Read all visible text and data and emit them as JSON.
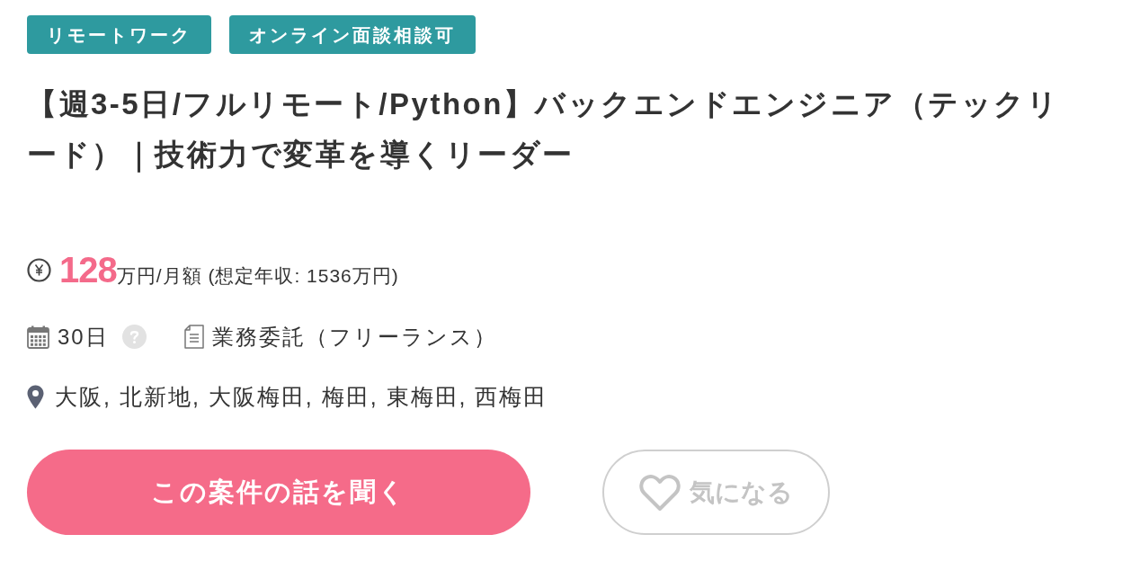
{
  "tags": [
    {
      "label": "リモートワーク"
    },
    {
      "label": "オンライン面談相談可"
    }
  ],
  "title": "【週3-5日/フルリモート/Python】バックエンドエンジニア（テックリード）｜技術力で変革を導くリーダー",
  "salary": {
    "amount": "128",
    "unit": "万円/月額 (想定年収: 1536万円)"
  },
  "details": [
    {
      "kind": "duration",
      "text": "30日"
    },
    {
      "kind": "contract",
      "text": "業務委託（フリーランス）"
    }
  ],
  "location": {
    "text": "大阪, 北新地, 大阪梅田, 梅田, 東梅田, 西梅田"
  },
  "actions": {
    "apply": {
      "label": "この案件の話を聞く"
    },
    "favorite": {
      "label": "気になる",
      "selected": false
    }
  }
}
